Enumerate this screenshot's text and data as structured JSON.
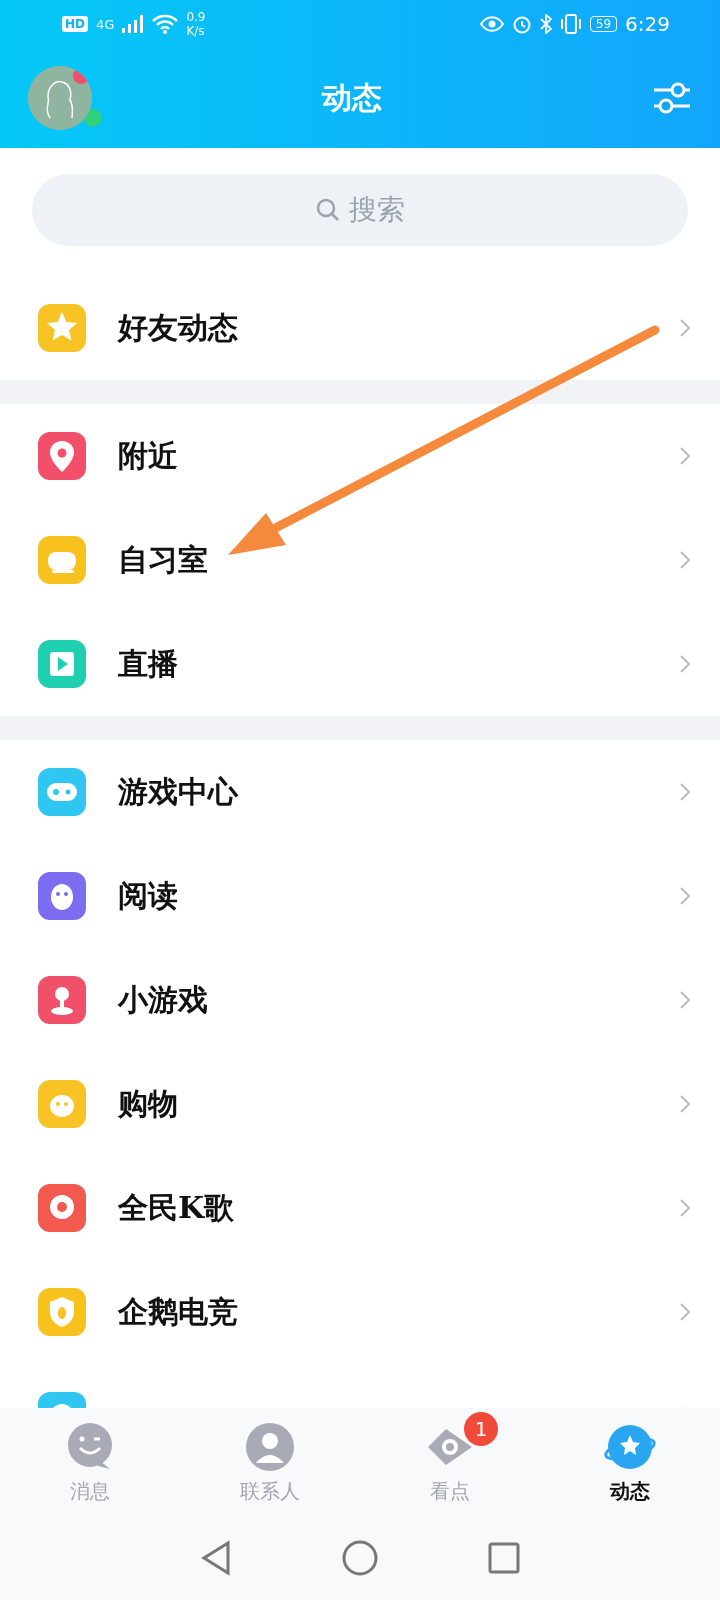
{
  "status_bar": {
    "hd": "HD",
    "network": "4G",
    "speed_value": "0.9",
    "speed_unit": "K/s",
    "battery": "59",
    "time": "6:29"
  },
  "header": {
    "title": "动态"
  },
  "search": {
    "placeholder": "搜索"
  },
  "groups": [
    {
      "items": [
        {
          "label": "好友动态",
          "color": "#f7c325"
        }
      ]
    },
    {
      "items": [
        {
          "label": "附近",
          "color": "#f2506a"
        },
        {
          "label": "自习室",
          "color": "#f8c21e"
        },
        {
          "label": "直播",
          "color": "#1fcfb0"
        }
      ]
    },
    {
      "items": [
        {
          "label": "游戏中心",
          "color": "#2fc7f2"
        },
        {
          "label": "阅读",
          "color": "#7b6cf0"
        },
        {
          "label": "小游戏",
          "color": "#f0506a"
        },
        {
          "label": "购物",
          "color": "#f7c325"
        },
        {
          "label": "全民K歌",
          "color": "#f25a4f"
        },
        {
          "label": "企鹅电竞",
          "color": "#f8c21e"
        },
        {
          "color": "#2fc7f2"
        }
      ]
    }
  ],
  "tabs": [
    {
      "label": "消息",
      "selected": false
    },
    {
      "label": "联系人",
      "selected": false
    },
    {
      "label": "看点",
      "selected": false,
      "badge": "1"
    },
    {
      "label": "动态",
      "selected": true
    }
  ]
}
